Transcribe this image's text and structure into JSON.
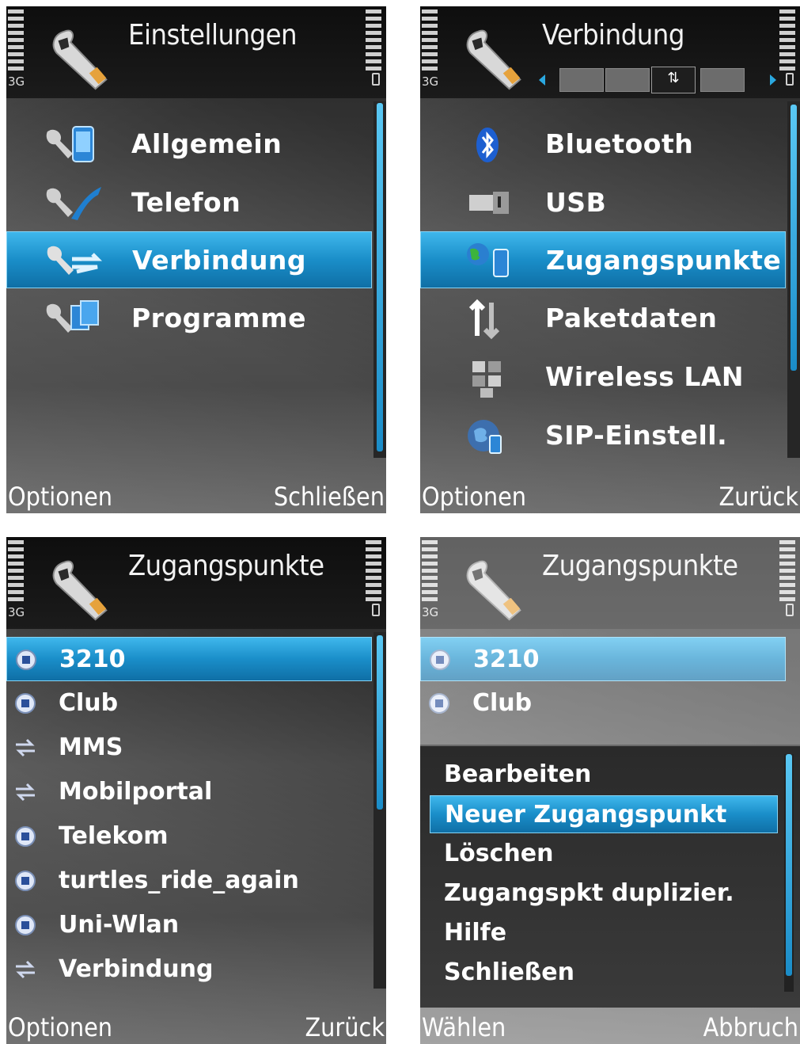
{
  "screens": {
    "settings": {
      "network": "3G",
      "title": "Einstellungen",
      "items": [
        {
          "label": "Allgemein"
        },
        {
          "label": "Telefon"
        },
        {
          "label": "Verbindung"
        },
        {
          "label": "Programme"
        }
      ],
      "selected_index": 2,
      "softkey_left": "Optionen",
      "softkey_right": "Schließen"
    },
    "connection": {
      "network": "3G",
      "title": "Verbindung",
      "active_tab_glyph": "⇅",
      "items": [
        {
          "label": "Bluetooth",
          "icon": "bluetooth-icon"
        },
        {
          "label": "USB",
          "icon": "usb-icon"
        },
        {
          "label": "Zugangspunkte",
          "icon": "access-point-icon"
        },
        {
          "label": "Paketdaten",
          "icon": "packet-data-icon"
        },
        {
          "label": "Wireless LAN",
          "icon": "wlan-icon"
        },
        {
          "label": "SIP-Einstell.",
          "icon": "sip-icon"
        }
      ],
      "selected_index": 2,
      "softkey_left": "Optionen",
      "softkey_right": "Zurück"
    },
    "access_points": {
      "network": "3G",
      "title": "Zugangspunkte",
      "items": [
        {
          "label": "3210",
          "icon": "globe-icon"
        },
        {
          "label": "Club",
          "icon": "globe-icon"
        },
        {
          "label": "MMS",
          "icon": "arrows-icon"
        },
        {
          "label": "Mobilportal",
          "icon": "arrows-icon"
        },
        {
          "label": "Telekom",
          "icon": "globe-icon"
        },
        {
          "label": "turtles_ride_again",
          "icon": "globe-icon"
        },
        {
          "label": "Uni-Wlan",
          "icon": "globe-icon"
        },
        {
          "label": "Verbindung",
          "icon": "arrows-icon"
        }
      ],
      "selected_index": 0,
      "softkey_left": "Optionen",
      "softkey_right": "Zurück"
    },
    "access_points_menu": {
      "network": "3G",
      "title": "Zugangspunkte",
      "background_items": [
        {
          "label": "3210"
        },
        {
          "label": "Club"
        }
      ],
      "menu_items": [
        {
          "label": "Bearbeiten"
        },
        {
          "label": "Neuer Zugangspunkt"
        },
        {
          "label": "Löschen"
        },
        {
          "label": "Zugangspkt duplizier."
        },
        {
          "label": "Hilfe"
        },
        {
          "label": "Schließen"
        }
      ],
      "selected_index": 1,
      "softkey_left": "Wählen",
      "softkey_right": "Abbruch"
    }
  },
  "colors": {
    "highlight": "#1a8ec9",
    "scrollbar": "#2aa8e0"
  }
}
